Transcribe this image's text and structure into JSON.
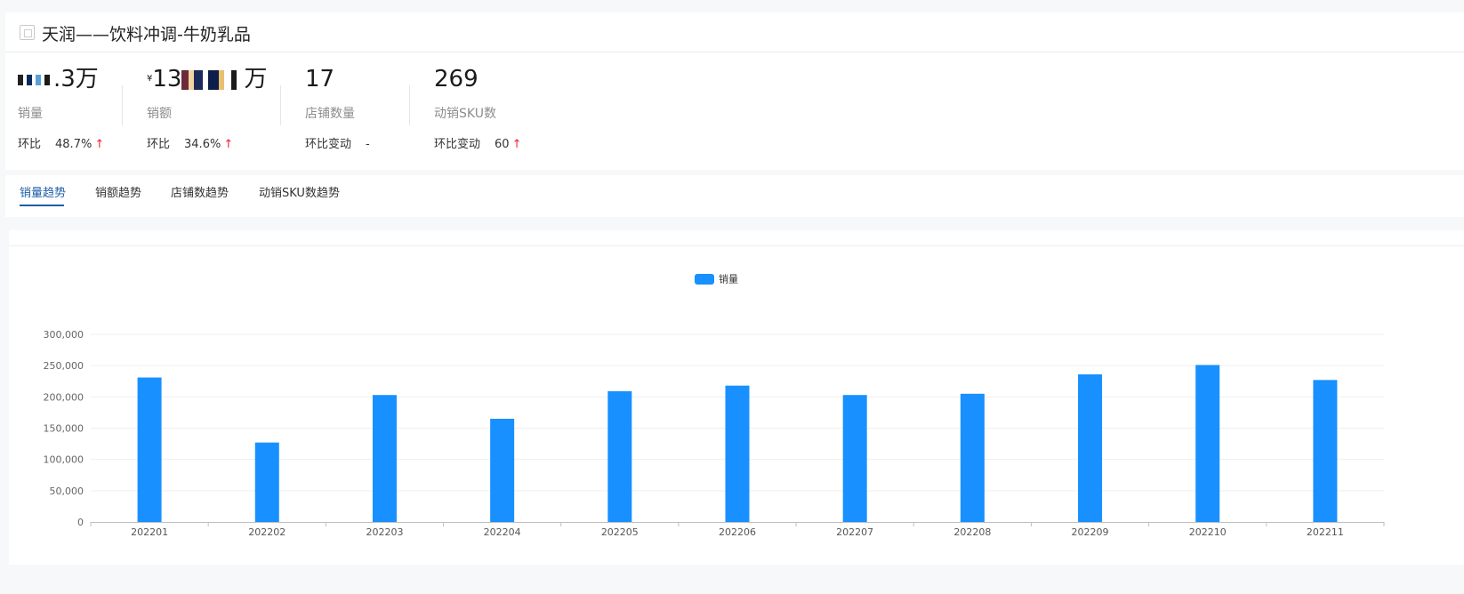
{
  "header": {
    "title": "天润——饮料冲调-牛奶乳品"
  },
  "metrics": [
    {
      "value_suffix": ".3万",
      "label": "销量",
      "change_label": "环比",
      "change_value": "48.7%",
      "trend": "up"
    },
    {
      "value_prefix": "¥",
      "value_text": "13",
      "value_suffix": "万",
      "label": "销额",
      "change_label": "环比",
      "change_value": "34.6%",
      "trend": "up"
    },
    {
      "value_text": "17",
      "label": "店铺数量",
      "change_label": "环比变动",
      "change_value": "-",
      "trend": "none"
    },
    {
      "value_text": "269",
      "label": "动销SKU数",
      "change_label": "环比变动",
      "change_value": "60",
      "trend": "up"
    }
  ],
  "arrow_glyph": "↑",
  "tabs": [
    {
      "label": "销量趋势",
      "active": true
    },
    {
      "label": "销额趋势",
      "active": false
    },
    {
      "label": "店铺数趋势",
      "active": false
    },
    {
      "label": "动销SKU数趋势",
      "active": false
    }
  ],
  "colors": {
    "bar": "#1890ff",
    "tab_active": "#1d5ea8",
    "arrow_up": "#f5222d"
  },
  "chart_data": {
    "type": "bar",
    "categories": [
      "202201",
      "202202",
      "202203",
      "202204",
      "202205",
      "202206",
      "202207",
      "202208",
      "202209",
      "202210",
      "202211"
    ],
    "series": [
      {
        "name": "销量",
        "values": [
          231000,
          127000,
          203000,
          165000,
          209000,
          218000,
          203000,
          205000,
          236000,
          251000,
          227000
        ]
      }
    ],
    "ylim": [
      0,
      300000
    ],
    "yticks": [
      "0",
      "50,000",
      "100,000",
      "150,000",
      "200,000",
      "250,000",
      "300,000"
    ],
    "legend_position": "top-center",
    "grid": true
  }
}
